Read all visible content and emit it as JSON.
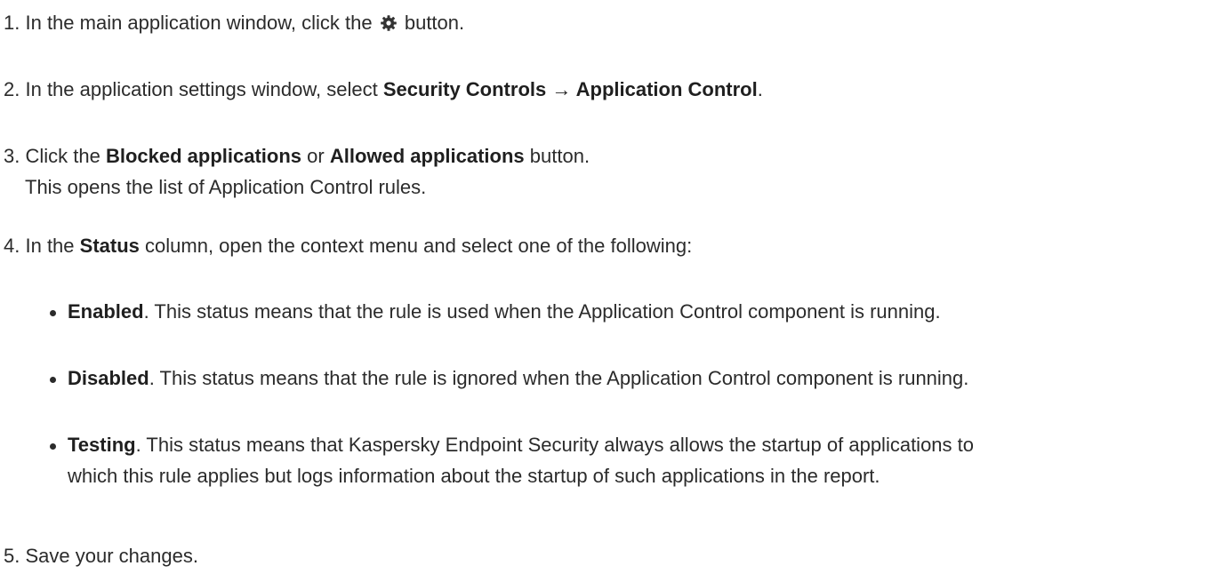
{
  "steps": [
    {
      "number": "1.",
      "text_before": "In the main application window, click the",
      "icon": "gear-icon",
      "text_after": "button."
    },
    {
      "number": "2.",
      "text_before": "In the application settings window, select",
      "bold_1": "Security Controls → Application Control",
      "text_after": "."
    },
    {
      "number": "3.",
      "text_before": "Click the",
      "bold_1": "Blocked applications",
      "text_middle": "or",
      "bold_2": "Allowed applications",
      "text_after": "button.",
      "note": "This opens the list of Application Control rules."
    },
    {
      "number": "4.",
      "text_before": "In the",
      "bold_1": "Status",
      "text_after": "column, open the context menu and select one of the following:",
      "options": [
        {
          "term": "Enabled",
          "description": ". This status means that the rule is used when the Application Control component is running."
        },
        {
          "term": "Disabled",
          "description": ". This status means that the rule is ignored when the Application Control component is running."
        },
        {
          "term": "Testing",
          "description_line1": ". This status means that Kaspersky Endpoint Security always allows the startup of applications to",
          "description_line2": "which this rule applies but logs information about the startup of such applications in the report."
        }
      ]
    },
    {
      "number": "5.",
      "text": "Save your changes."
    }
  ]
}
